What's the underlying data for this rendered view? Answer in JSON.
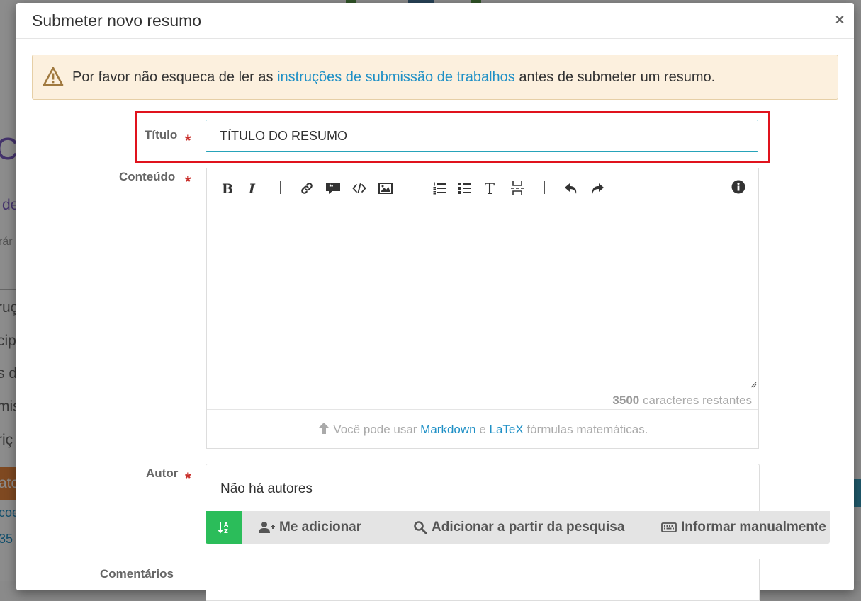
{
  "background": {
    "frag_a": "Co",
    "frag_b": "de",
    "frag_c": "rár",
    "frag_d": "ruç",
    "frag_e": "cip",
    "frag_f": "s d",
    "frag_g": "mis",
    "frag_h": "riç",
    "frag_i": "ato",
    "frag_j": "coe",
    "frag_k": "35"
  },
  "modal": {
    "title": "Submeter novo resumo",
    "close_label": "×"
  },
  "alert": {
    "text_before": "Por favor não esqueca de ler as ",
    "link": "instruções de submissão de trabalhos",
    "text_after": " antes de submeter um resumo."
  },
  "form": {
    "title_label": "Título",
    "title_value": "TÍTULO DO RESUMO",
    "content_label": "Conteúdo",
    "required_mark": "*",
    "chars_count": "3500",
    "chars_text": " caracteres restantes",
    "footer_before": "Você pode usar ",
    "footer_markdown": "Markdown",
    "footer_and": " e ",
    "footer_latex": "LaTeX",
    "footer_after": " fórmulas matemáticas.",
    "author_label": "Autor",
    "author_empty": "Não há autores",
    "add_me": "Me adicionar",
    "add_search": "Adicionar a partir da pesquisa",
    "add_manual": "Informar manualmente",
    "comments_label": "Comentários"
  },
  "toolbar_icons": [
    "bold-icon",
    "italic-icon",
    "link-icon",
    "quote-icon",
    "code-icon",
    "image-icon",
    "ordered-list-icon",
    "unordered-list-icon",
    "heading-icon",
    "horizontal-rule-icon",
    "undo-icon",
    "redo-icon",
    "info-icon"
  ],
  "colors": {
    "accent": "#1f90c6",
    "required": "#c9302c",
    "highlight": "#e0131d",
    "alert_bg": "#fcf0de",
    "sort_button": "#2bbd5a"
  }
}
